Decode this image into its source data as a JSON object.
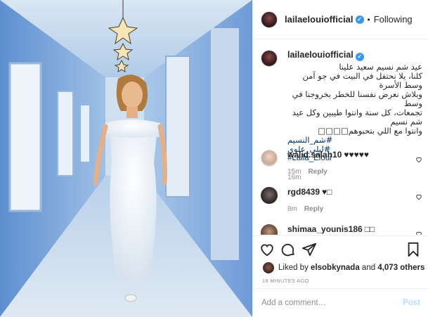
{
  "post": {
    "author": "lailaelouiofficial",
    "follow_status": "Following",
    "separator": "•",
    "verified_mark": "✓",
    "caption_author": "lailaelouiofficial",
    "caption_lines": [
      "عيد شم نسيم سعيد علينا",
      "كلنا، يلا نحتفل في البيت في جو آمن وسط الأسرة",
      "وبلاش نعرض نفسنا للخطر بخروجنا في وسط",
      "تجمعات، كل سنة وانتوا طيبين وكل عيد شم نسيم",
      "وانتوا مع اللي بتحبوهم□□□□"
    ],
    "hashtags": [
      "#شم_النسيم",
      "#ليلى_علوي",
      "#Laila_Eloui"
    ],
    "caption_time": "16m"
  },
  "comments": [
    {
      "user": "walid.salah10",
      "text": "♥♥♥♥♥",
      "time": "15m",
      "reply": "Reply"
    },
    {
      "user": "rgd8439",
      "text": "♥□",
      "time": "8m",
      "reply": "Reply"
    },
    {
      "user": "shimaa_younis186",
      "text": "□□",
      "time": "",
      "reply": ""
    }
  ],
  "likes": {
    "prefix": "Liked by",
    "user": "elsobkynada",
    "connector": "and",
    "count": "4,073 others"
  },
  "timestamp": "16 MINUTES AGO",
  "add_comment": {
    "placeholder": "Add a comment…",
    "post_label": "Post"
  },
  "icons": {
    "like": "heart-icon",
    "comment": "comment-icon",
    "share": "share-icon",
    "save": "bookmark-icon"
  },
  "colors": {
    "accent": "#3897f0",
    "link": "#003569",
    "muted": "#8e8e8e",
    "post_disabled": "#b2dffc"
  }
}
